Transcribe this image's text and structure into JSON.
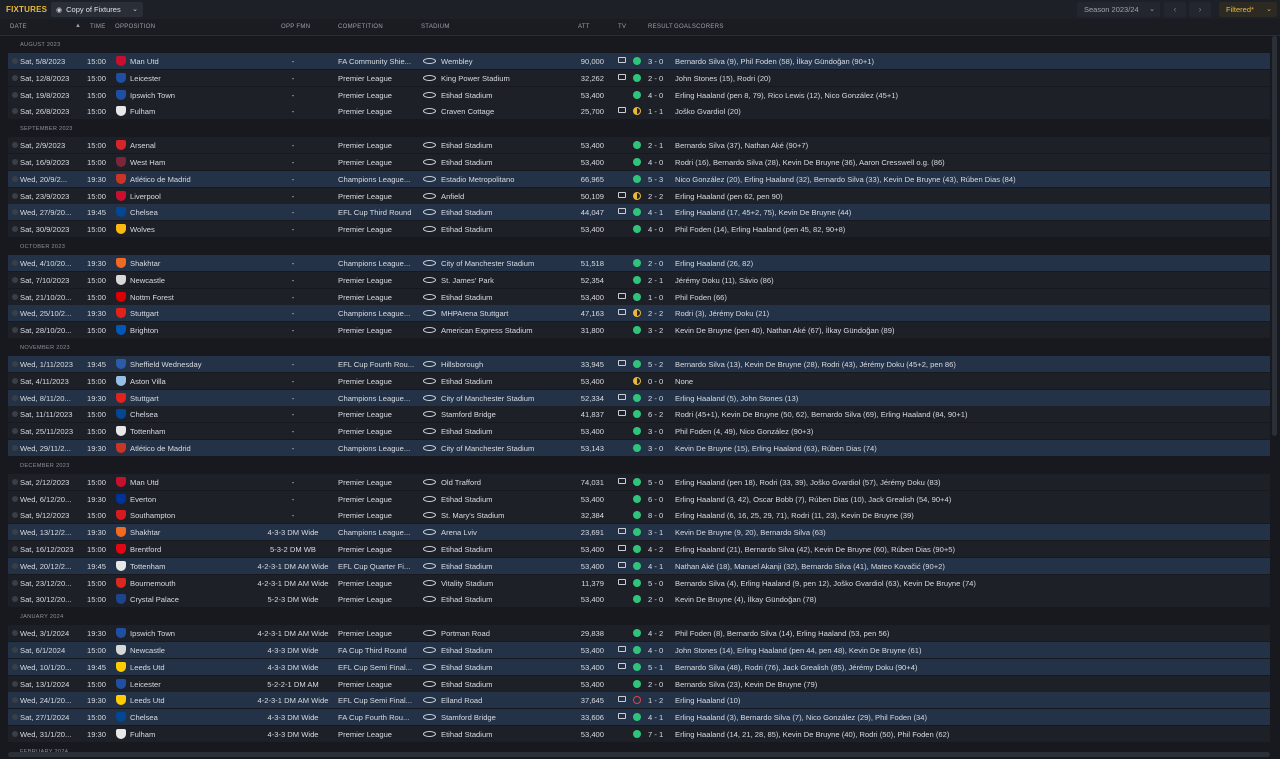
{
  "header": {
    "title": "FIXTURES",
    "view_label": "Copy of Fixtures",
    "season_label": "Season 2023/24",
    "filter_label": "Filtered*"
  },
  "columns": {
    "date": "DATE",
    "time": "TIME",
    "opposition": "OPPOSITION",
    "opp_fmn": "OPP FMN",
    "competition": "COMPETITION",
    "stadium": "STADIUM",
    "att": "ATT",
    "tv": "TV",
    "result": "RESULT",
    "goalscorers": "GOALSCORERS"
  },
  "colors": {
    "accent": "#e8b93a",
    "win": "#2fc47a",
    "draw": "#e8b93a",
    "loss": "#e0444e",
    "row": "#1d2027",
    "row_highlight": "#233247"
  },
  "months": [
    {
      "label": "AUGUST 2023"
    },
    {
      "label": "SEPTEMBER 2023"
    },
    {
      "label": "OCTOBER 2023"
    },
    {
      "label": "NOVEMBER 2023"
    },
    {
      "label": "DECEMBER 2023"
    },
    {
      "label": "JANUARY 2024"
    },
    {
      "label": "FEBRUARY 2024"
    }
  ],
  "fixtures": [
    {
      "date": "Sat, 5/8/2023",
      "time": "15:00",
      "opp": "Man Utd",
      "crest": "#c8102e",
      "fmn": "-",
      "comp": "FA Community Shie...",
      "stadium": "Wembley",
      "att": "90,000",
      "tv": true,
      "res": "win",
      "score": "3 - 0",
      "scorers": "Bernardo Silva (9), Phil Foden (58), İlkay Gündoğan (90+1)",
      "og": "",
      "hl": true
    },
    {
      "date": "Sat, 12/8/2023",
      "time": "15:00",
      "opp": "Leicester",
      "crest": "#1f4fa3",
      "fmn": "-",
      "comp": "Premier League",
      "stadium": "King Power Stadium",
      "att": "32,262",
      "tv": true,
      "res": "win",
      "score": "2 - 0",
      "scorers": "John Stones (15), Rodri (20)",
      "og": "",
      "hl": false
    },
    {
      "date": "Sat, 19/8/2023",
      "time": "15:00",
      "opp": "Ipswich Town",
      "crest": "#1f4fa3",
      "fmn": "-",
      "comp": "Premier League",
      "stadium": "Etihad Stadium",
      "att": "53,400",
      "tv": false,
      "res": "win",
      "score": "4 - 0",
      "scorers": "Erling Haaland (pen 8, 79), Rico Lewis (12), Nico González (45+1)",
      "og": "",
      "hl": false
    },
    {
      "date": "Sat, 26/8/2023",
      "time": "15:00",
      "opp": "Fulham",
      "crest": "#e8e8e8",
      "fmn": "-",
      "comp": "Premier League",
      "stadium": "Craven Cottage",
      "att": "25,700",
      "tv": true,
      "res": "draw",
      "score": "1 - 1",
      "scorers": "Joško Gvardiol (20)",
      "og": "",
      "hl": false
    },
    {
      "date": "Sat, 2/9/2023",
      "time": "15:00",
      "opp": "Arsenal",
      "crest": "#d8232a",
      "fmn": "-",
      "comp": "Premier League",
      "stadium": "Etihad Stadium",
      "att": "53,400",
      "tv": false,
      "res": "win",
      "score": "2 - 1",
      "scorers": "Bernardo Silva (37), Nathan Aké (90+7)",
      "og": "",
      "hl": false
    },
    {
      "date": "Sat, 16/9/2023",
      "time": "15:00",
      "opp": "West Ham",
      "crest": "#7a263a",
      "fmn": "-",
      "comp": "Premier League",
      "stadium": "Etihad Stadium",
      "att": "53,400",
      "tv": false,
      "res": "win",
      "score": "4 - 0",
      "scorers": "Rodri (16), Bernardo Silva (28), Kevin De Bruyne (36), ",
      "og": "Aaron Cresswell o.g. (86)",
      "hl": false
    },
    {
      "date": "Wed, 20/9/2...",
      "time": "19:30",
      "opp": "Atlético de Madrid",
      "crest": "#cb3524",
      "fmn": "-",
      "comp": "Champions League...",
      "stadium": "Estadio Metropolitano",
      "att": "66,965",
      "tv": false,
      "res": "win",
      "score": "5 - 3",
      "scorers": "Nico González (20), Erling Haaland (32), Bernardo Silva (33), Kevin De Bruyne (43), Rúben Dias (84)",
      "og": "",
      "hl": true
    },
    {
      "date": "Sat, 23/9/2023",
      "time": "15:00",
      "opp": "Liverpool",
      "crest": "#c8102e",
      "fmn": "-",
      "comp": "Premier League",
      "stadium": "Anfield",
      "att": "50,109",
      "tv": true,
      "res": "draw",
      "score": "2 - 2",
      "scorers": "Erling Haaland (pen 62, pen 90)",
      "og": "",
      "hl": false
    },
    {
      "date": "Wed, 27/9/20...",
      "time": "19:45",
      "opp": "Chelsea",
      "crest": "#034694",
      "fmn": "-",
      "comp": "EFL Cup Third Round",
      "stadium": "Etihad Stadium",
      "att": "44,047",
      "tv": true,
      "res": "win",
      "score": "4 - 1",
      "scorers": "Erling Haaland (17, 45+2, 75), Kevin De Bruyne (44)",
      "og": "",
      "hl": true
    },
    {
      "date": "Sat, 30/9/2023",
      "time": "15:00",
      "opp": "Wolves",
      "crest": "#fdb913",
      "fmn": "-",
      "comp": "Premier League",
      "stadium": "Etihad Stadium",
      "att": "53,400",
      "tv": false,
      "res": "win",
      "score": "4 - 0",
      "scorers": "Phil Foden (14), Erling Haaland (pen 45, 82, 90+8)",
      "og": "",
      "hl": false
    },
    {
      "date": "Wed, 4/10/20...",
      "time": "19:30",
      "opp": "Shakhtar",
      "crest": "#f26a21",
      "fmn": "-",
      "comp": "Champions League...",
      "stadium": "City of Manchester Stadium",
      "att": "51,518",
      "tv": false,
      "res": "win",
      "score": "2 - 0",
      "scorers": "Erling Haaland (26, 82)",
      "og": "",
      "hl": true
    },
    {
      "date": "Sat, 7/10/2023",
      "time": "15:00",
      "opp": "Newcastle",
      "crest": "#d8d8d8",
      "fmn": "-",
      "comp": "Premier League",
      "stadium": "St. James' Park",
      "att": "52,354",
      "tv": false,
      "res": "win",
      "score": "2 - 1",
      "scorers": "Jérémy Doku (11), Sávio (86)",
      "og": "",
      "hl": false
    },
    {
      "date": "Sat, 21/10/20...",
      "time": "15:00",
      "opp": "Nottm Forest",
      "crest": "#dd0000",
      "fmn": "-",
      "comp": "Premier League",
      "stadium": "Etihad Stadium",
      "att": "53,400",
      "tv": true,
      "res": "win",
      "score": "1 - 0",
      "scorers": "Phil Foden (66)",
      "og": "",
      "hl": false
    },
    {
      "date": "Wed, 25/10/2...",
      "time": "19:30",
      "opp": "Stuttgart",
      "crest": "#e32219",
      "fmn": "-",
      "comp": "Champions League...",
      "stadium": "MHPArena Stuttgart",
      "att": "47,163",
      "tv": true,
      "res": "draw",
      "score": "2 - 2",
      "scorers": "Rodri (3), Jérémy Doku (21)",
      "og": "",
      "hl": true
    },
    {
      "date": "Sat, 28/10/20...",
      "time": "15:00",
      "opp": "Brighton",
      "crest": "#0057b8",
      "fmn": "-",
      "comp": "Premier League",
      "stadium": "American Express Stadium",
      "att": "31,800",
      "tv": false,
      "res": "win",
      "score": "3 - 2",
      "scorers": "Kevin De Bruyne (pen 40), Nathan Aké (67), İlkay Gündoğan (89)",
      "og": "",
      "hl": false
    },
    {
      "date": "Wed, 1/11/2023",
      "time": "19:45",
      "opp": "Sheffield Wednesday",
      "crest": "#2b5ca8",
      "fmn": "-",
      "comp": "EFL Cup Fourth Rou...",
      "stadium": "Hillsborough",
      "att": "33,945",
      "tv": true,
      "res": "win",
      "score": "5 - 2",
      "scorers": "Bernardo Silva (13), Kevin De Bruyne (28), Rodri (43), Jérémy Doku (45+2, pen 86)",
      "og": "",
      "hl": true
    },
    {
      "date": "Sat, 4/11/2023",
      "time": "15:00",
      "opp": "Aston Villa",
      "crest": "#95bfe5",
      "fmn": "-",
      "comp": "Premier League",
      "stadium": "Etihad Stadium",
      "att": "53,400",
      "tv": false,
      "res": "draw",
      "score": "0 - 0",
      "scorers": "None",
      "og": "",
      "hl": false
    },
    {
      "date": "Wed, 8/11/20...",
      "time": "19:30",
      "opp": "Stuttgart",
      "crest": "#e32219",
      "fmn": "-",
      "comp": "Champions League...",
      "stadium": "City of Manchester Stadium",
      "att": "52,334",
      "tv": true,
      "res": "win",
      "score": "2 - 0",
      "scorers": "Erling Haaland (5), John Stones (13)",
      "og": "",
      "hl": true
    },
    {
      "date": "Sat, 11/11/2023",
      "time": "15:00",
      "opp": "Chelsea",
      "crest": "#034694",
      "fmn": "-",
      "comp": "Premier League",
      "stadium": "Stamford Bridge",
      "att": "41,837",
      "tv": true,
      "res": "win",
      "score": "6 - 2",
      "scorers": "Rodri (45+1), Kevin De Bruyne (50, 62), Bernardo Silva (69), Erling Haaland (84, 90+1)",
      "og": "",
      "hl": false
    },
    {
      "date": "Sat, 25/11/2023",
      "time": "15:00",
      "opp": "Tottenham",
      "crest": "#e8e8e8",
      "fmn": "-",
      "comp": "Premier League",
      "stadium": "Etihad Stadium",
      "att": "53,400",
      "tv": false,
      "res": "win",
      "score": "3 - 0",
      "scorers": "Phil Foden (4, 49), Nico González (90+3)",
      "og": "",
      "hl": false
    },
    {
      "date": "Wed, 29/11/2...",
      "time": "19:30",
      "opp": "Atlético de Madrid",
      "crest": "#cb3524",
      "fmn": "-",
      "comp": "Champions League...",
      "stadium": "City of Manchester Stadium",
      "att": "53,143",
      "tv": false,
      "res": "win",
      "score": "3 - 0",
      "scorers": "Kevin De Bruyne (15), Erling Haaland (63), Rúben Dias (74)",
      "og": "",
      "hl": true
    },
    {
      "date": "Sat, 2/12/2023",
      "time": "15:00",
      "opp": "Man Utd",
      "crest": "#c8102e",
      "fmn": "-",
      "comp": "Premier League",
      "stadium": "Old Trafford",
      "att": "74,031",
      "tv": true,
      "res": "win",
      "score": "5 - 0",
      "scorers": "Erling Haaland (pen 18), Rodri (33, 39), Joško Gvardiol (57), Jérémy Doku (83)",
      "og": "",
      "hl": false
    },
    {
      "date": "Wed, 6/12/20...",
      "time": "19:30",
      "opp": "Everton",
      "crest": "#003399",
      "fmn": "-",
      "comp": "Premier League",
      "stadium": "Etihad Stadium",
      "att": "53,400",
      "tv": false,
      "res": "win",
      "score": "6 - 0",
      "scorers": "Erling Haaland (3, 42), Oscar Bobb (7), Rúben Dias (10), Jack Grealish (54, 90+4)",
      "og": "",
      "hl": false
    },
    {
      "date": "Sat, 9/12/2023",
      "time": "15:00",
      "opp": "Southampton",
      "crest": "#d71920",
      "fmn": "-",
      "comp": "Premier League",
      "stadium": "St. Mary's Stadium",
      "att": "32,384",
      "tv": false,
      "res": "win",
      "score": "8 - 0",
      "scorers": "Erling Haaland (6, 16, 25, 29, 71), Rodri (11, 23), Kevin De Bruyne (39)",
      "og": "",
      "hl": false
    },
    {
      "date": "Wed, 13/12/2...",
      "time": "19:30",
      "opp": "Shakhtar",
      "crest": "#f26a21",
      "fmn": "4-3-3 DM Wide",
      "comp": "Champions League...",
      "stadium": "Arena Lviv",
      "att": "23,691",
      "tv": true,
      "res": "win",
      "score": "3 - 1",
      "scorers": "Kevin De Bruyne (9, 20), Bernardo Silva (63)",
      "og": "",
      "hl": true
    },
    {
      "date": "Sat, 16/12/2023",
      "time": "15:00",
      "opp": "Brentford",
      "crest": "#e30613",
      "fmn": "5-3-2 DM WB",
      "comp": "Premier League",
      "stadium": "Etihad Stadium",
      "att": "53,400",
      "tv": true,
      "res": "win",
      "score": "4 - 2",
      "scorers": "Erling Haaland (21), Bernardo Silva (42), Kevin De Bruyne (60), Rúben Dias (90+5)",
      "og": "",
      "hl": false
    },
    {
      "date": "Wed, 20/12/2...",
      "time": "19:45",
      "opp": "Tottenham",
      "crest": "#e8e8e8",
      "fmn": "4-2-3-1 DM AM Wide",
      "comp": "EFL Cup Quarter Fi...",
      "stadium": "Etihad Stadium",
      "att": "53,400",
      "tv": true,
      "res": "win",
      "score": "4 - 1",
      "scorers": "Nathan Aké (18), Manuel Akanji (32), Bernardo Silva (41), Mateo Kovačić (90+2)",
      "og": "",
      "hl": true
    },
    {
      "date": "Sat, 23/12/20...",
      "time": "15:00",
      "opp": "Bournemouth",
      "crest": "#da291c",
      "fmn": "4-2-3-1 DM AM Wide",
      "comp": "Premier League",
      "stadium": "Vitality Stadium",
      "att": "11,379",
      "tv": true,
      "res": "win",
      "score": "5 - 0",
      "scorers": "Bernardo Silva (4), Erling Haaland (9, pen 12), Joško Gvardiol (63), Kevin De Bruyne (74)",
      "og": "",
      "hl": false
    },
    {
      "date": "Sat, 30/12/20...",
      "time": "15:00",
      "opp": "Crystal Palace",
      "crest": "#1b458f",
      "fmn": "5-2-3 DM Wide",
      "comp": "Premier League",
      "stadium": "Etihad Stadium",
      "att": "53,400",
      "tv": false,
      "res": "win",
      "score": "2 - 0",
      "scorers": "Kevin De Bruyne (4), İlkay Gündoğan (78)",
      "og": "",
      "hl": false
    },
    {
      "date": "Wed, 3/1/2024",
      "time": "19:30",
      "opp": "Ipswich Town",
      "crest": "#1f4fa3",
      "fmn": "4-2-3-1 DM AM Wide",
      "comp": "Premier League",
      "stadium": "Portman Road",
      "att": "29,838",
      "tv": false,
      "res": "win",
      "score": "4 - 2",
      "scorers": "Phil Foden (8), Bernardo Silva (14), Erling Haaland (53, pen 56)",
      "og": "",
      "hl": false
    },
    {
      "date": "Sat, 6/1/2024",
      "time": "15:00",
      "opp": "Newcastle",
      "crest": "#d8d8d8",
      "fmn": "4-3-3 DM Wide",
      "comp": "FA Cup Third Round",
      "stadium": "Etihad Stadium",
      "att": "53,400",
      "tv": true,
      "res": "win",
      "score": "4 - 0",
      "scorers": "John Stones (14), Erling Haaland (pen 44, pen 48), Kevin De Bruyne (61)",
      "og": "",
      "hl": true
    },
    {
      "date": "Wed, 10/1/20...",
      "time": "19:45",
      "opp": "Leeds Utd",
      "crest": "#ffcd00",
      "fmn": "4-3-3 DM Wide",
      "comp": "EFL Cup Semi Final...",
      "stadium": "Etihad Stadium",
      "att": "53,400",
      "tv": true,
      "res": "win",
      "score": "5 - 1",
      "scorers": "Bernardo Silva (48), Rodri (76), Jack Grealish (85), Jérémy Doku (90+4)",
      "og": "",
      "hl": true
    },
    {
      "date": "Sat, 13/1/2024",
      "time": "15:00",
      "opp": "Leicester",
      "crest": "#1f4fa3",
      "fmn": "5-2-2-1 DM AM",
      "comp": "Premier League",
      "stadium": "Etihad Stadium",
      "att": "53,400",
      "tv": false,
      "res": "win",
      "score": "2 - 0",
      "scorers": "Bernardo Silva (23), Kevin De Bruyne (79)",
      "og": "",
      "hl": false
    },
    {
      "date": "Wed, 24/1/20...",
      "time": "19:30",
      "opp": "Leeds Utd",
      "crest": "#ffcd00",
      "fmn": "4-2-3-1 DM AM Wide",
      "comp": "EFL Cup Semi Final...",
      "stadium": "Elland Road",
      "att": "37,645",
      "tv": true,
      "res": "loss",
      "score": "1 - 2",
      "scorers": "Erling Haaland (10)",
      "og": "",
      "hl": true
    },
    {
      "date": "Sat, 27/1/2024",
      "time": "15:00",
      "opp": "Chelsea",
      "crest": "#034694",
      "fmn": "4-3-3 DM Wide",
      "comp": "FA Cup Fourth Rou...",
      "stadium": "Stamford Bridge",
      "att": "33,606",
      "tv": true,
      "res": "win",
      "score": "4 - 1",
      "scorers": "Erling Haaland (3), Bernardo Silva (7), Nico González (29), Phil Foden (34)",
      "og": "",
      "hl": true
    },
    {
      "date": "Wed, 31/1/20...",
      "time": "19:30",
      "opp": "Fulham",
      "crest": "#e8e8e8",
      "fmn": "4-3-3 DM Wide",
      "comp": "Premier League",
      "stadium": "Etihad Stadium",
      "att": "53,400",
      "tv": false,
      "res": "win",
      "score": "7 - 1",
      "scorers": "Erling Haaland (14, 21, 28, 85), Kevin De Bruyne (40), Rodri (50), Phil Foden (62)",
      "og": "",
      "hl": false
    }
  ]
}
